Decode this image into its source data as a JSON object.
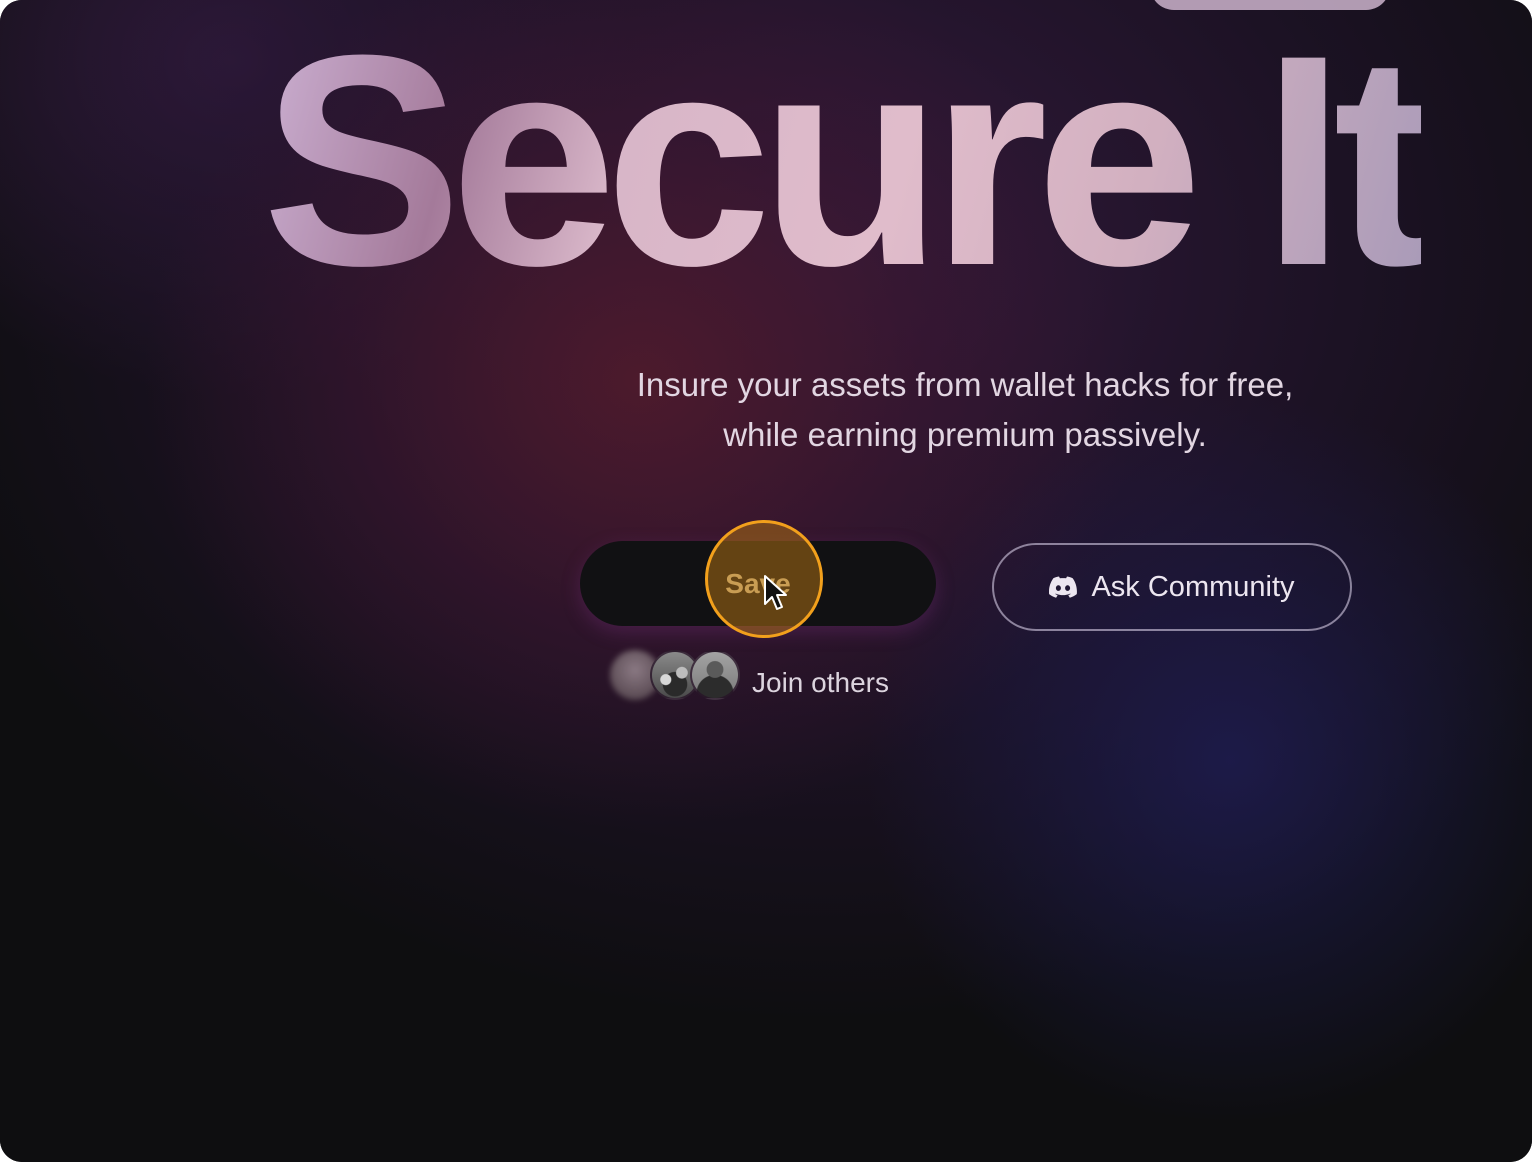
{
  "hero": {
    "title": "Secure It",
    "subtitle_line1": "Insure your assets from wallet hacks for free,",
    "subtitle_line2": "while earning premium passively."
  },
  "actions": {
    "primary_label": "Save",
    "secondary_label": "Ask Community",
    "secondary_icon": "discord-icon"
  },
  "social_proof": {
    "label": "Join others",
    "avatar_count": 3
  },
  "colors": {
    "background": "#0e0e10",
    "primary_button_bg": "#111113",
    "primary_button_text": "#f0d7a0",
    "click_highlight": "#f2a01c",
    "secondary_button_border": "#c8bed7"
  }
}
